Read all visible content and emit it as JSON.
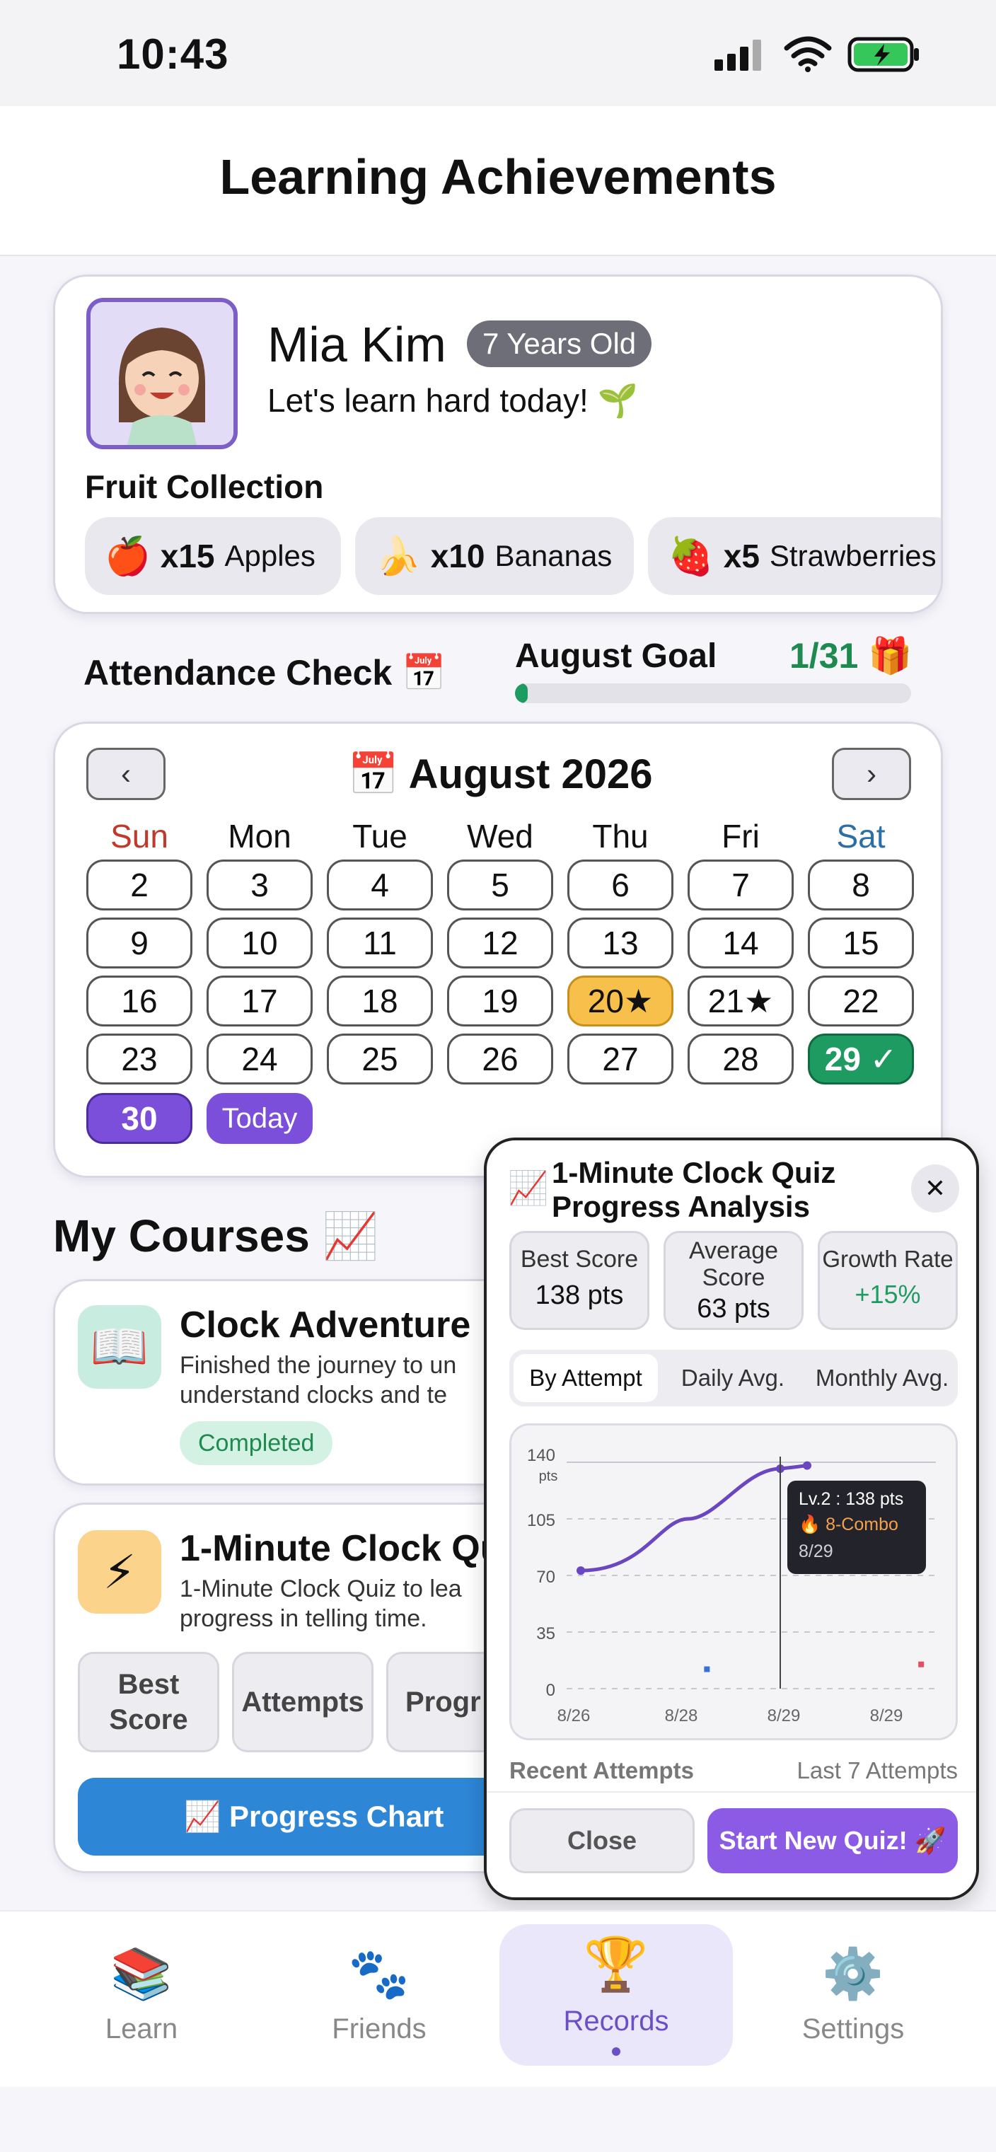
{
  "status": {
    "time": "10:43"
  },
  "page": {
    "title": "Learning Achievements"
  },
  "profile": {
    "name": "Mia Kim",
    "age_badge": "7 Years Old",
    "message": "Let's learn hard today! 🌱",
    "fruit_title": "Fruit Collection",
    "fruits": [
      {
        "icon": "🍎",
        "count": "x15",
        "label": "Apples"
      },
      {
        "icon": "🍌",
        "count": "x10",
        "label": "Bananas"
      },
      {
        "icon": "🍓",
        "count": "x5",
        "label": "Strawberries"
      }
    ]
  },
  "attendance": {
    "title": "Attendance Check 📅",
    "goal_label": "August Goal",
    "goal_value": "1/31 🎁",
    "goal_progress": 0.032
  },
  "calendar": {
    "month": "📅 August 2026",
    "prev": "‹",
    "next": "›",
    "weekdays": [
      "Sun",
      "Mon",
      "Tue",
      "Wed",
      "Thu",
      "Fri",
      "Sat"
    ],
    "days": [
      "2",
      "3",
      "4",
      "5",
      "6",
      "7",
      "8",
      "9",
      "10",
      "11",
      "12",
      "13",
      "14",
      "15",
      "16",
      "17",
      "18",
      "19",
      "20★",
      "21★",
      "22",
      "23",
      "24",
      "25",
      "26",
      "27",
      "28",
      "29 ✓",
      "30",
      "Today"
    ],
    "colors": {
      "sun": "#c0392b",
      "sat": "#2a6fa8",
      "star": "#f7c04a",
      "check": "#1e9b61",
      "today": "#7b4fd9"
    }
  },
  "courses": {
    "title": "My Courses 📈",
    "clock_adventure": {
      "icon": "📖",
      "title": "Clock Adventure",
      "desc_line1": "Finished the journey to un",
      "desc_line2": "understand clocks and te",
      "status": "Completed"
    },
    "clock_quiz": {
      "icon": "⚡",
      "title": "1-Minute Clock Qu",
      "desc_line1": "1-Minute Clock Quiz to lea",
      "desc_line2": "progress in telling time.",
      "stat_buttons": [
        "Best Score",
        "Attempts",
        "Progr"
      ],
      "progress_button": "📈 Progress Chart"
    }
  },
  "popup": {
    "icon": "📈",
    "title_line1": "1-Minute Clock Quiz",
    "title_line2": "Progress Analysis",
    "close_icon": "✕",
    "stats": [
      {
        "label": "Best Score",
        "value": "138 pts"
      },
      {
        "label": "Average Score",
        "value": "63 pts"
      },
      {
        "label": "Growth Rate",
        "value": "+15%"
      }
    ],
    "tabs": [
      "By Attempt",
      "Daily Avg.",
      "Monthly Avg."
    ],
    "recent_label": "Recent Attempts",
    "recent_right": "Last 7 Attempts",
    "close_button": "Close",
    "start_button": "Start New Quiz! 🚀"
  },
  "chart_data": {
    "type": "line",
    "x_ticks": [
      "8/26",
      "8/28",
      "8/29",
      "8/29"
    ],
    "ylabel_unit": "pts",
    "ylim": [
      0,
      140
    ],
    "y_ticks": [
      "0",
      "35",
      "70",
      "105",
      "140"
    ],
    "series": [
      {
        "values": [
          73,
          105,
          136,
          137,
          138
        ]
      }
    ],
    "extra_points": [
      {
        "x": 0.38,
        "y": 12,
        "color": "#3a6fd8"
      },
      {
        "x": 0.96,
        "y": 15,
        "color": "#e05060"
      }
    ],
    "tooltip": {
      "line1": "Lv.2 : 138 pts",
      "line2": "🔥 8-Combo",
      "line3": "8/29"
    },
    "grid": true
  },
  "tabs": [
    {
      "icon": "📚",
      "label": "Learn"
    },
    {
      "icon": "🐾",
      "label": "Friends"
    },
    {
      "icon": "🏆",
      "label": "Records"
    },
    {
      "icon": "⚙️",
      "label": "Settings"
    }
  ]
}
